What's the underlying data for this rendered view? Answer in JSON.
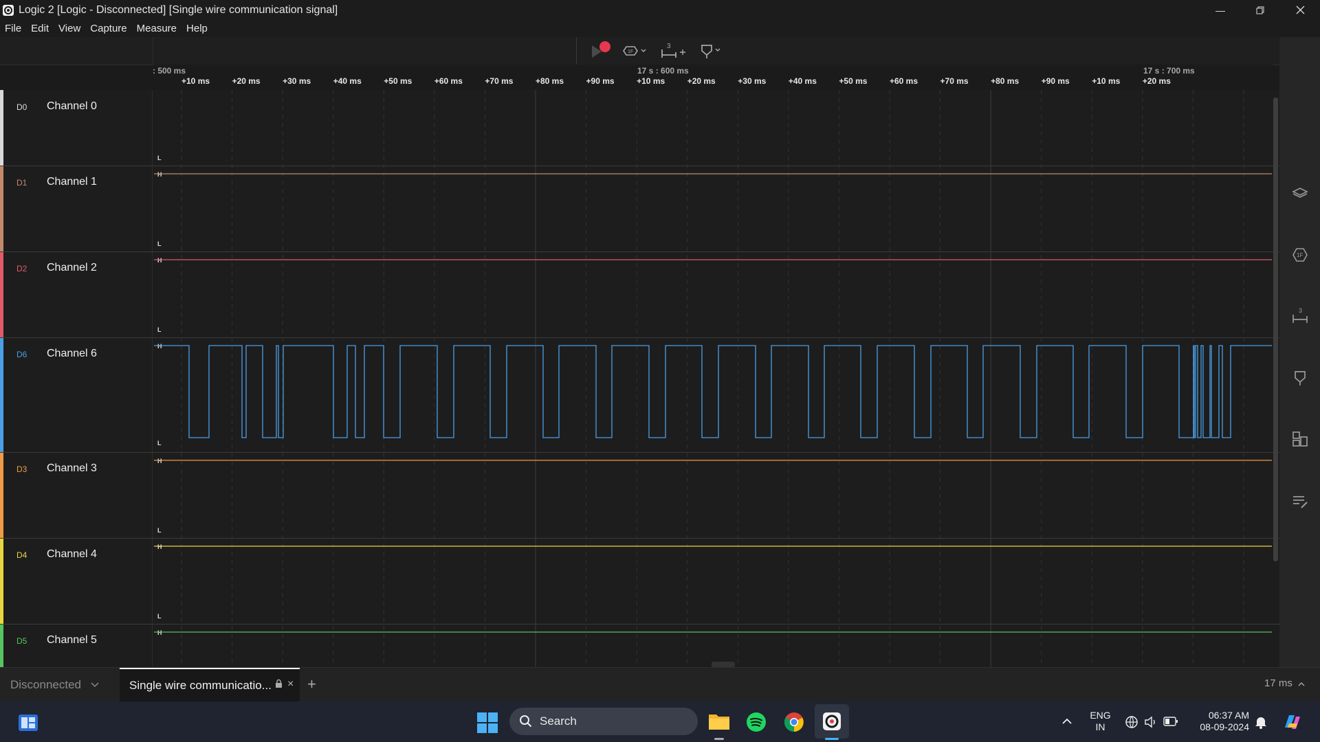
{
  "window": {
    "title": "Logic 2 [Logic - Disconnected] [Single wire communication signal]",
    "minimize_icon": "minimize-icon",
    "maximize_icon": "restore-icon",
    "close_icon": "close-icon"
  },
  "menu": [
    "File",
    "Edit",
    "View",
    "Capture",
    "Measure",
    "Help"
  ],
  "timeline": {
    "markers": [
      {
        "label": ": 500 ms",
        "major": true
      },
      {
        "label": "17 s : 600 ms",
        "major": true
      },
      {
        "label": "17 s : 700 ms",
        "major": true
      }
    ],
    "ticks": [
      "+10 ms",
      "+20 ms",
      "+30 ms",
      "+40 ms",
      "+50 ms",
      "+60 ms",
      "+70 ms",
      "+80 ms",
      "+90 ms",
      "+10 ms",
      "+20 ms",
      "+30 ms",
      "+40 ms",
      "+50 ms",
      "+60 ms",
      "+70 ms",
      "+80 ms",
      "+90 ms",
      "+10 ms",
      "+20 ms"
    ]
  },
  "channels": [
    {
      "id": "D0",
      "name": "Channel 0",
      "color": "#d9d9d9",
      "high_label": "",
      "low_label": "L"
    },
    {
      "id": "D1",
      "name": "Channel 1",
      "color": "#c28a6b",
      "high_label": "H",
      "low_label": "L"
    },
    {
      "id": "D2",
      "name": "Channel 2",
      "color": "#e05a6a",
      "high_label": "H",
      "low_label": "L"
    },
    {
      "id": "D6",
      "name": "Channel 6",
      "color": "#4a9fe8",
      "high_label": "H",
      "low_label": "L"
    },
    {
      "id": "D3",
      "name": "Channel 3",
      "color": "#f09a45",
      "high_label": "H",
      "low_label": "L"
    },
    {
      "id": "D4",
      "name": "Channel 4",
      "color": "#e8d640",
      "high_label": "H",
      "low_label": "L"
    },
    {
      "id": "D5",
      "name": "Channel 5",
      "color": "#56c45f",
      "high_label": "H",
      "low_label": ""
    }
  ],
  "toolbar": {
    "record_icon": "play-record-icon",
    "trigger_icon": "trigger-icon",
    "measure_icon": "measure-icon",
    "measure_badge": "3",
    "marker_icon": "marker-icon"
  },
  "right_sidebar": [
    "analyzers-icon",
    "trigger-icon",
    "measurements-icon",
    "markers-icon",
    "extensions-icon",
    "notes-icon"
  ],
  "bottom": {
    "device": "Disconnected",
    "tab_label": "Single wire communicatio...",
    "add_tab": "+",
    "duration": "17 ms"
  },
  "taskbar": {
    "search_placeholder": "Search",
    "lang_top": "ENG",
    "lang_bottom": "IN",
    "time": "06:37 AM",
    "date": "08-09-2024"
  }
}
